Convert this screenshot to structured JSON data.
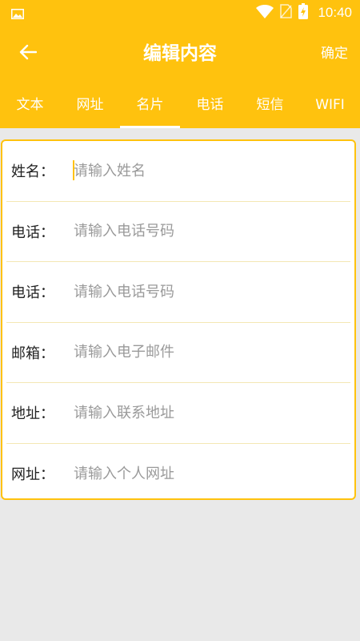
{
  "status_bar": {
    "time": "10:40",
    "icons": [
      "gallery-icon",
      "wifi-icon",
      "no-sim-icon",
      "battery-charging-icon"
    ]
  },
  "app_bar": {
    "title": "编辑内容",
    "confirm_label": "确定",
    "back_icon": "arrow-left-icon"
  },
  "tabs": [
    {
      "label": "文本"
    },
    {
      "label": "网址"
    },
    {
      "label": "名片",
      "active": true
    },
    {
      "label": "电话"
    },
    {
      "label": "短信"
    },
    {
      "label": "WIFI"
    }
  ],
  "form": {
    "fields": [
      {
        "label": "姓名：",
        "placeholder": "请输入姓名",
        "value": ""
      },
      {
        "label": "电话：",
        "placeholder": "请输入电话号码",
        "value": ""
      },
      {
        "label": "电话：",
        "placeholder": "请输入电话号码",
        "value": ""
      },
      {
        "label": "邮箱：",
        "placeholder": "请输入电子邮件",
        "value": ""
      },
      {
        "label": "地址：",
        "placeholder": "请输入联系地址",
        "value": ""
      },
      {
        "label": "网址：",
        "placeholder": "请输入个人网址",
        "value": ""
      }
    ]
  },
  "colors": {
    "accent": "#ffc20e",
    "background": "#e9e9e9",
    "card": "#ffffff",
    "placeholder": "#9a9a9a",
    "label": "#222222"
  }
}
